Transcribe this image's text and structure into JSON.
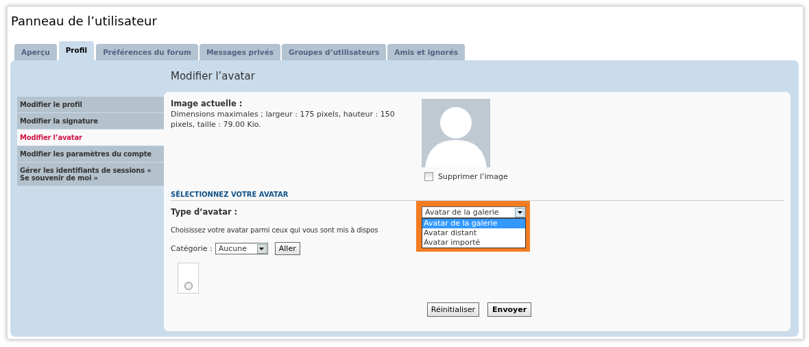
{
  "page_title": "Panneau de l’utilisateur",
  "tabs": [
    {
      "label": "Aperçu",
      "selected": false
    },
    {
      "label": "Profil",
      "selected": true
    },
    {
      "label": "Préférences du forum",
      "selected": false
    },
    {
      "label": "Messages privés",
      "selected": false
    },
    {
      "label": "Groupes d’utilisateurs",
      "selected": false
    },
    {
      "label": "Amis et ignorés",
      "selected": false
    }
  ],
  "panel_title": "Modifier l’avatar",
  "sidebar": {
    "items": [
      {
        "label": "Modifier le profil",
        "selected": false
      },
      {
        "label": "Modifier la signature",
        "selected": false
      },
      {
        "label": "Modifier l’avatar",
        "selected": true
      },
      {
        "label": "Modifier les paramètres du compte",
        "selected": false
      },
      {
        "label": "Gérer les identifiants de sessions « Se souvenir de moi »",
        "selected": false
      }
    ]
  },
  "current_image": {
    "label": "Image actuelle :",
    "description": "Dimensions maximales ; largeur : 175 pixels, hauteur : 150 pixels, taille : 79.00 Kio.",
    "delete_checkbox": {
      "label": "Supprimer l’image",
      "checked": false
    }
  },
  "section_title": "SÉLECTIONNEZ VOTRE AVATAR",
  "avatar_type": {
    "label": "Type d’avatar :",
    "dropdown": {
      "value": "Avatar de la galerie",
      "highlighted": true,
      "expanded": true,
      "options": [
        {
          "label": "Avatar de la galerie",
          "selected": true
        },
        {
          "label": "Avatar distant",
          "selected": false
        },
        {
          "label": "Avatar importé",
          "selected": false
        }
      ]
    }
  },
  "instruction": "Choisissez votre avatar parmi ceux qui vous sont mis à dispos",
  "category": {
    "label": "Catégorie :",
    "value": "Aucune",
    "go_button": "Aller"
  },
  "gallery": [
    {
      "selected": false
    }
  ],
  "buttons": [
    {
      "label": "Réinitialiser",
      "kind": "reset"
    },
    {
      "label": "Envoyer",
      "kind": "primary"
    }
  ]
}
